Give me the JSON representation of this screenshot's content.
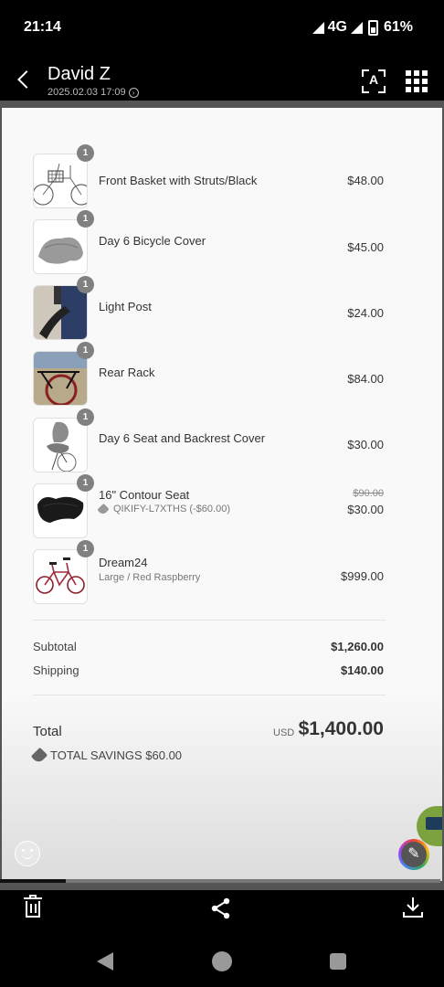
{
  "status": {
    "time": "21:14",
    "network": "4G",
    "battery": "61%"
  },
  "header": {
    "title": "David Z",
    "subtitle": "2025.02.03 17:09"
  },
  "order": {
    "items": [
      {
        "qty": "1",
        "name": "Front Basket with Struts/Black",
        "price": "$48.00",
        "thumb": "basket"
      },
      {
        "qty": "1",
        "name": "Day 6 Bicycle Cover",
        "price": "$45.00",
        "thumb": "cover"
      },
      {
        "qty": "1",
        "name": "Light Post",
        "price": "$24.00",
        "thumb": "post"
      },
      {
        "qty": "1",
        "name": "Rear Rack",
        "price": "$84.00",
        "thumb": "rack"
      },
      {
        "qty": "1",
        "name": "Day 6 Seat and Backrest Cover",
        "price": "$30.00",
        "thumb": "seatcover"
      },
      {
        "qty": "1",
        "name": "16\" Contour Seat",
        "discount": "QIKIFY-L7XTHS (-$60.00)",
        "original_price": "$90.00",
        "price": "$30.00",
        "thumb": "seat"
      },
      {
        "qty": "1",
        "name": "Dream24",
        "variant": "Large / Red Raspberry",
        "price": "$999.00",
        "thumb": "bike"
      }
    ],
    "subtotal_label": "Subtotal",
    "subtotal": "$1,260.00",
    "shipping_label": "Shipping",
    "shipping": "$140.00",
    "total_label": "Total",
    "currency": "USD",
    "total": "$1,400.00",
    "savings": "TOTAL SAVINGS $60.00"
  },
  "icons": {
    "ocr": "text-recognition-icon",
    "apps": "grid-icon",
    "delete": "trash-icon",
    "share": "share-icon",
    "download": "download-icon",
    "edit": "pencil-icon"
  },
  "colors": {
    "background": "#000000",
    "document": "#f9f9f9",
    "badge": "#808080",
    "bubble": "#7ba23f"
  }
}
